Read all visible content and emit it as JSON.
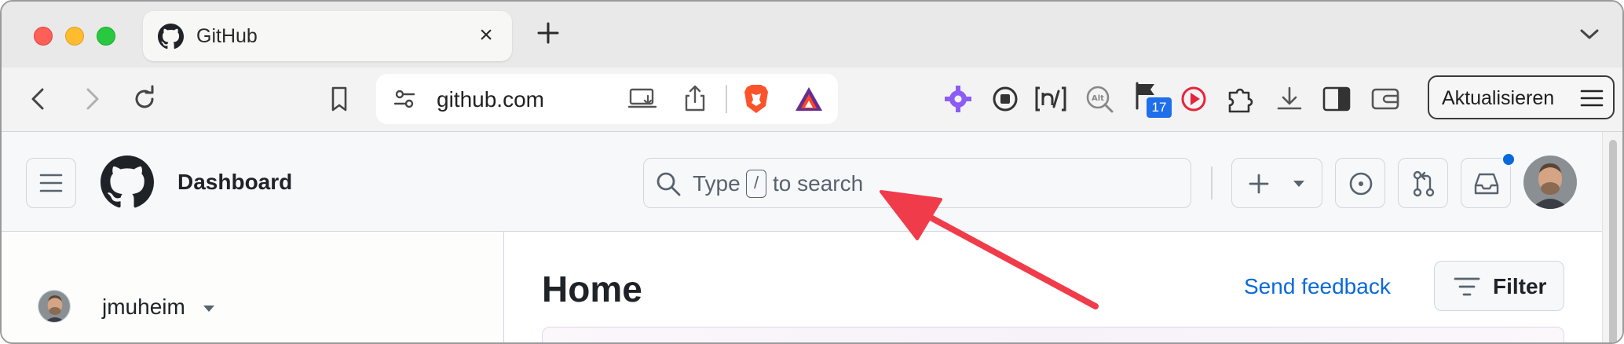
{
  "tab": {
    "title": "GitHub"
  },
  "address_bar": {
    "url": "github.com"
  },
  "toolbar": {
    "notification_count": "17",
    "update_button_label": "Aktualisieren"
  },
  "header": {
    "title": "Dashboard",
    "search": {
      "prefix": "Type",
      "key": "/",
      "suffix": "to search"
    }
  },
  "sidebar": {
    "username": "jmuheim"
  },
  "main": {
    "heading": "Home",
    "send_feedback": "Send feedback",
    "filter_label": "Filter"
  },
  "colors": {
    "accent_blue": "#0969da",
    "annotation_arrow": "#f03c4a"
  },
  "icons": [
    "github-logo-icon",
    "close-icon",
    "plus-icon",
    "chevron-down-icon",
    "back-icon",
    "forward-icon",
    "reload-icon",
    "bookmark-icon",
    "site-settings-icon",
    "install-app-icon",
    "share-icon",
    "brave-shields-icon",
    "brave-rewards-icon",
    "extensions-gear-icon",
    "stop-record-icon",
    "hypothesis-icon",
    "alt-text-icon",
    "flag-icon",
    "play-icon",
    "puzzle-icon",
    "download-icon",
    "sidebar-icon",
    "wallet-icon",
    "hamburger-icon",
    "search-icon",
    "issues-icon",
    "pull-request-icon",
    "inbox-icon",
    "filter-icon"
  ]
}
